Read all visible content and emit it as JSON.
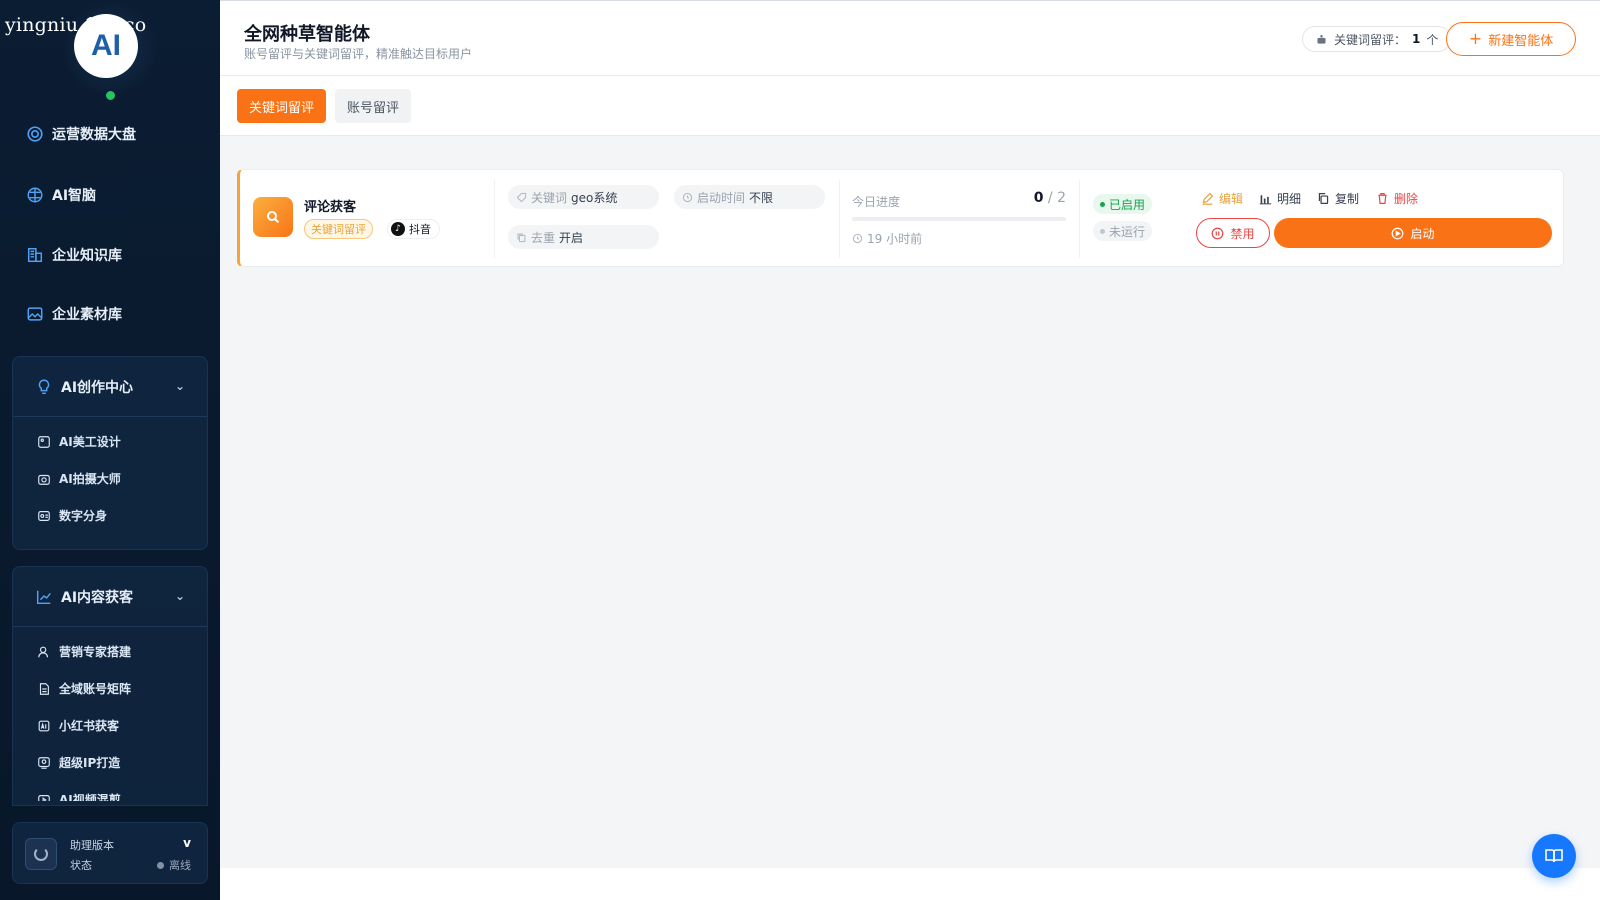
{
  "watermark": "yingniu.10v.co",
  "brand": {
    "logo_text": "AI"
  },
  "sidebar": {
    "items": [
      {
        "label": "运营数据大盘",
        "icon": "dashboard-icon"
      },
      {
        "label": "AI智脑",
        "icon": "brain-icon"
      },
      {
        "label": "企业知识库",
        "icon": "building-icon"
      },
      {
        "label": "企业素材库",
        "icon": "image-icon"
      }
    ],
    "groups": [
      {
        "title": "AI创作中心",
        "icon": "bulb-icon",
        "items": [
          {
            "label": "AI美工设计"
          },
          {
            "label": "AI拍摄大师"
          },
          {
            "label": "数字分身"
          }
        ]
      },
      {
        "title": "AI内容获客",
        "icon": "chart-icon",
        "items": [
          {
            "label": "营销专家搭建"
          },
          {
            "label": "全域账号矩阵"
          },
          {
            "label": "小红书获客"
          },
          {
            "label": "超级IP打造"
          },
          {
            "label": "AI视频混剪"
          }
        ]
      }
    ],
    "assistant": {
      "version_label": "助理版本",
      "version_value": "v",
      "status_label": "状态",
      "status_value": "离线"
    }
  },
  "header": {
    "title": "全网种草智能体",
    "subtitle": "账号留评与关键词留评，精准触达目标用户",
    "count_label": "关键词留评：",
    "count_value": "1",
    "count_unit": "个",
    "new_button": "新建智能体"
  },
  "tabs": [
    {
      "label": "关键词留评",
      "active": true
    },
    {
      "label": "账号留评",
      "active": false
    }
  ],
  "card": {
    "title": "评论获客",
    "type_tag": "关键词留评",
    "platform": "抖音",
    "keyword_label": "关键词",
    "keyword_value": "geo系统",
    "start_time_label": "启动时间",
    "start_time_value": "不限",
    "dedup_label": "去重",
    "dedup_value": "开启",
    "progress_label": "今日进度",
    "progress_done": "0",
    "progress_total": "/ 2",
    "progress_fraction": 0,
    "last_time": "19 小时前",
    "status_enabled": "已启用",
    "status_running": "未运行",
    "actions": {
      "edit": "编辑",
      "detail": "明细",
      "copy": "复制",
      "delete": "删除",
      "disable": "禁用",
      "start": "启动"
    }
  },
  "colors": {
    "accent": "#f97316",
    "sidebar_bg": "#0b1d33",
    "success": "#16a34a",
    "danger": "#ef4444",
    "edit": "#e6a23c",
    "fab": "#1677ff"
  }
}
